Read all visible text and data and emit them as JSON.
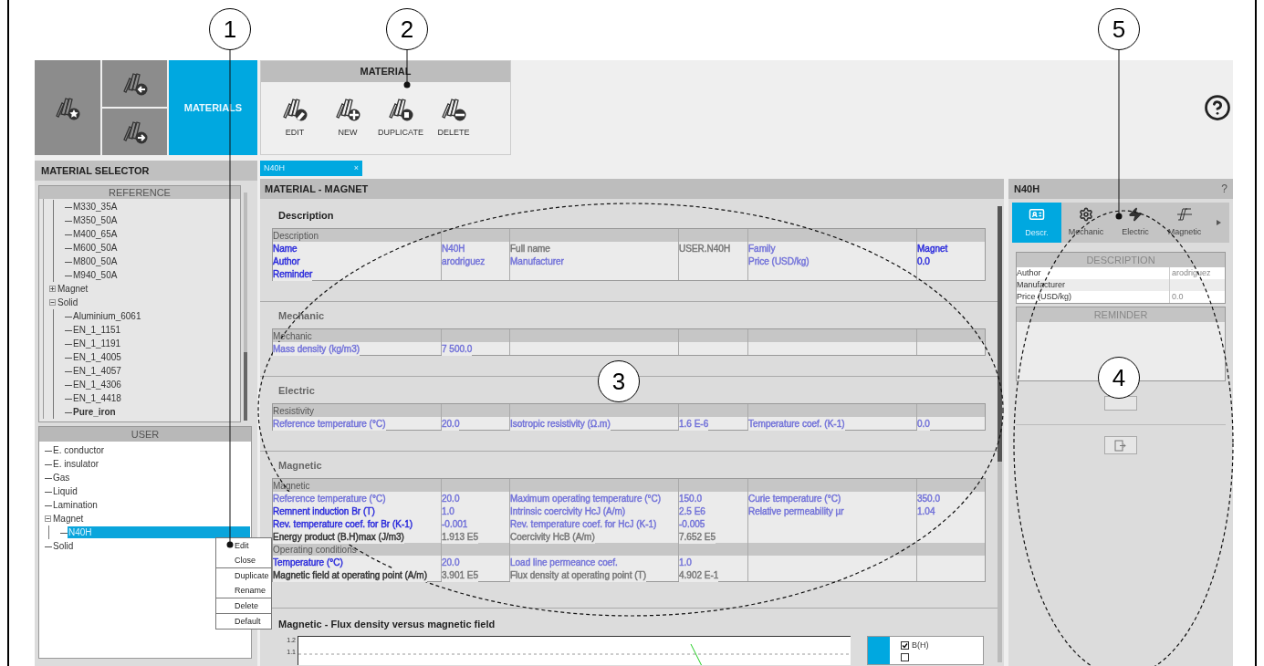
{
  "home_tiles": {
    "label": "MATERIALS",
    "selected": true
  },
  "toolbar": {
    "title": "MATERIAL",
    "buttons": [
      {
        "label": "EDIT",
        "kind": "edit"
      },
      {
        "label": "NEW",
        "kind": "new"
      },
      {
        "label": "DUPLICATE",
        "kind": "duplicate"
      },
      {
        "label": "DELETE",
        "kind": "delete"
      }
    ]
  },
  "selector": {
    "title": "MATERIAL SELECTOR",
    "reference": {
      "title": "REFERENCE",
      "tree": [
        {
          "expanded": true,
          "children": [
            {
              "label": "M330_35A",
              "selected": false
            },
            {
              "label": "M350_50A",
              "selected": false
            },
            {
              "label": "M400_65A",
              "selected": false
            },
            {
              "label": "M600_50A",
              "selected": false
            },
            {
              "label": "M800_50A",
              "selected": false
            },
            {
              "label": "M940_50A",
              "selected": false
            }
          ]
        },
        {
          "label": "Magnet",
          "expanded": false,
          "selected": false
        },
        {
          "label": "Solid",
          "expanded": true,
          "selected": false,
          "children": [
            {
              "label": "Aluminium_6061",
              "selected": false,
              "emphasized": false
            },
            {
              "label": "EN_1_1151",
              "selected": false,
              "emphasized": false
            },
            {
              "label": "EN_1_1191",
              "selected": false,
              "emphasized": false
            },
            {
              "label": "EN_1_4005",
              "selected": false,
              "emphasized": false
            },
            {
              "label": "EN_1_4057",
              "selected": false,
              "emphasized": false
            },
            {
              "label": "EN_1_4306",
              "selected": false,
              "emphasized": false
            },
            {
              "label": "EN_1_4418",
              "selected": false,
              "emphasized": false
            },
            {
              "label": "Pure_iron",
              "selected": false,
              "emphasized": true
            }
          ]
        }
      ]
    },
    "user": {
      "title": "USER",
      "tree": [
        {
          "label": "E. conductor",
          "selected": false
        },
        {
          "label": "E. insulator",
          "selected": false
        },
        {
          "label": "Gas",
          "selected": false
        },
        {
          "label": "Liquid",
          "selected": false
        },
        {
          "label": "Lamination",
          "selected": false
        },
        {
          "label": "Magnet",
          "expanded": true,
          "selected": false,
          "children": [
            {
              "label": "N40H",
              "selected": true
            }
          ]
        },
        {
          "label": "Solid",
          "selected": false
        }
      ]
    }
  },
  "context_menu": [
    [
      "Edit",
      "Close"
    ],
    [
      "Duplicate",
      "Rename"
    ],
    [
      "Delete"
    ],
    [
      "Default"
    ]
  ],
  "document_tab": {
    "label": "N40H",
    "close": "×",
    "selected": true
  },
  "main": {
    "title": "MATERIAL - MAGNET",
    "sections": [
      {
        "title": "Description",
        "rows": [
          {
            "kind": "header",
            "label": "Description"
          },
          {
            "kind": "data",
            "pairs": [
              {
                "label": {
                  "text": "Name",
                  "color": "#2b2bdc"
                },
                "value": {
                  "text": "N40H",
                  "color": "#7373d9"
                }
              },
              {
                "label": {
                  "text": "Full name",
                  "color": "#777777"
                },
                "value": {
                  "text": "USER.N40H",
                  "color": "#777777"
                }
              },
              {
                "label": {
                  "text": "Family",
                  "color": "#7373d9"
                },
                "value": {
                  "text": "Magnet",
                  "color": "#2b2bdc"
                }
              }
            ]
          },
          {
            "kind": "data",
            "pairs": [
              {
                "label": {
                  "text": "Author",
                  "color": "#2b2bdc"
                },
                "value": {
                  "text": "arodriguez",
                  "color": "#7373d9"
                }
              },
              {
                "label": {
                  "text": "Manufacturer",
                  "color": "#7373d9"
                }
              },
              {
                "label": {
                  "text": "Price (USD/kg)",
                  "color": "#7373d9"
                },
                "value": {
                  "text": "0.0",
                  "color": "#2b2bdc"
                }
              }
            ]
          },
          {
            "kind": "data",
            "pairs": [
              {
                "label": {
                  "text": "Reminder",
                  "color": "#2b2bdc"
                }
              }
            ]
          }
        ]
      },
      {
        "title": "Mechanic",
        "rows": [
          {
            "kind": "header",
            "label": "Mechanic"
          },
          {
            "kind": "data",
            "pairs": [
              {
                "label": {
                  "text": "Mass density (kg/m3)",
                  "color": "#7373d9"
                },
                "value": {
                  "text": "7 500.0",
                  "color": "#7373d9"
                }
              }
            ]
          }
        ]
      },
      {
        "title": "Electric",
        "rows": [
          {
            "kind": "header",
            "label": "Resistivity"
          },
          {
            "kind": "data",
            "pairs": [
              {
                "label": {
                  "text": "Reference temperature (°C)",
                  "color": "#7373d9"
                },
                "value": {
                  "text": "20.0",
                  "color": "#7373d9"
                }
              },
              {
                "label": {
                  "text": "Isotropic resistivity (Ω.m)",
                  "color": "#7373d9"
                },
                "value": {
                  "text": "1.6 E-6",
                  "color": "#7373d9"
                }
              },
              {
                "label": {
                  "text": "Temperature coef. (K-1)",
                  "color": "#7373d9"
                },
                "value": {
                  "text": "0.0",
                  "color": "#7373d9"
                }
              }
            ]
          }
        ]
      },
      {
        "title": "Magnetic",
        "rows": [
          {
            "kind": "header",
            "label": "Magnetic"
          },
          {
            "kind": "data",
            "pairs": [
              {
                "label": {
                  "text": "Reference temperature (°C)",
                  "color": "#7373d9"
                },
                "value": {
                  "text": "20.0",
                  "color": "#7373d9"
                }
              },
              {
                "label": {
                  "text": "Maximum operating temperature (°C)",
                  "color": "#7373d9"
                },
                "value": {
                  "text": "150.0",
                  "color": "#7373d9"
                }
              },
              {
                "label": {
                  "text": "Curie temperature (°C)",
                  "color": "#7373d9"
                },
                "value": {
                  "text": "350.0",
                  "color": "#7373d9"
                }
              }
            ]
          },
          {
            "kind": "data",
            "pairs": [
              {
                "label": {
                  "text": "Remnent induction Br (T)",
                  "color": "#2b2bdc"
                },
                "value": {
                  "text": "1.0",
                  "color": "#7373d9"
                }
              },
              {
                "label": {
                  "text": "Intrinsic coercivity HcJ (A/m)",
                  "color": "#7373d9"
                },
                "value": {
                  "text": "2.5 E6",
                  "color": "#7373d9"
                }
              },
              {
                "label": {
                  "text": "Relative permeability µr",
                  "color": "#7373d9"
                },
                "value": {
                  "text": "1.04",
                  "color": "#7373d9"
                }
              }
            ]
          },
          {
            "kind": "data",
            "pairs": [
              {
                "label": {
                  "text": "Rev. temperature coef. for Br (K-1)",
                  "color": "#2b2bdc"
                },
                "value": {
                  "text": "-0.001",
                  "color": "#7373d9"
                }
              },
              {
                "label": {
                  "text": "Rev. temperature coef. for HcJ (K-1)",
                  "color": "#7373d9"
                },
                "value": {
                  "text": "-0.005",
                  "color": "#7373d9"
                }
              }
            ]
          },
          {
            "kind": "data",
            "pairs": [
              {
                "label": {
                  "text": "Energy product (B.H)max (J/m3)",
                  "color": "#333333"
                },
                "value": {
                  "text": "1.913 E5",
                  "color": "#777777"
                }
              },
              {
                "label": {
                  "text": "Coercivity HcB (A/m)",
                  "color": "#777777"
                },
                "value": {
                  "text": "7.652 E5",
                  "color": "#777777"
                }
              }
            ]
          },
          {
            "kind": "header",
            "label": "Operating conditions"
          },
          {
            "kind": "data",
            "pairs": [
              {
                "label": {
                  "text": "Temperature (°C)",
                  "color": "#2b2bdc"
                },
                "value": {
                  "text": "20.0",
                  "color": "#7373d9"
                }
              },
              {
                "label": {
                  "text": "Load line permeance coef.",
                  "color": "#7373d9"
                },
                "value": {
                  "text": "1.0",
                  "color": "#7373d9"
                }
              }
            ]
          },
          {
            "kind": "data",
            "pairs": [
              {
                "label": {
                  "text": "Magnetic field at operating point (A/m)",
                  "color": "#333333"
                },
                "value": {
                  "text": "3.901 E5",
                  "color": "#777777"
                }
              },
              {
                "label": {
                  "text": "Flux density at operating point (T)",
                  "color": "#777777"
                },
                "value": {
                  "text": "4.902 E-1",
                  "color": "#777777"
                }
              }
            ]
          }
        ]
      }
    ],
    "plot": {
      "title": "Magnetic - Flux density versus magnetic field",
      "tick_labels": [
        "1.2",
        "1.1"
      ],
      "legend": [
        {
          "label": "B(H)",
          "checked": true
        },
        {
          "checked": false
        }
      ]
    }
  },
  "properties": {
    "title": "N40H",
    "help": "?",
    "tabs": [
      {
        "label": "Descr.",
        "kind": "card",
        "selected": true
      },
      {
        "label": "Mechanic",
        "kind": "gear",
        "selected": false
      },
      {
        "label": "Electric",
        "kind": "bolt",
        "selected": false
      },
      {
        "label": "Magnetic",
        "kind": "loop",
        "selected": false
      }
    ],
    "description": {
      "title": "DESCRIPTION",
      "rows": [
        {
          "label": "Author",
          "value": "arodriguez"
        },
        {
          "label": "Manufacturer"
        },
        {
          "label": "Price (USD/kg)",
          "value": "0.0"
        }
      ]
    },
    "reminder": {
      "title": "REMINDER"
    }
  },
  "callouts": [
    {
      "number": "1"
    },
    {
      "number": "2"
    },
    {
      "number": "5"
    },
    {
      "number": "3"
    },
    {
      "number": "4"
    }
  ]
}
